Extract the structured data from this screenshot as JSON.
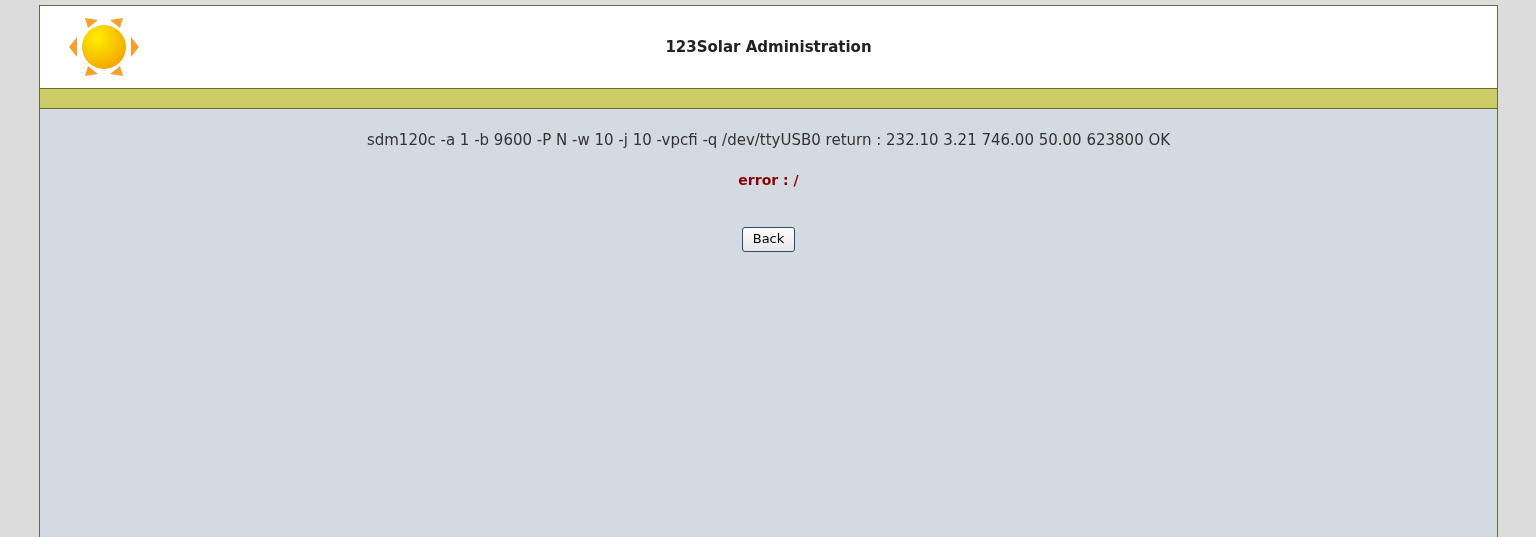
{
  "header": {
    "title": "123Solar Administration"
  },
  "content": {
    "command_output": "sdm120c -a 1 -b 9600 -P N -w 10 -j 10 -vpcfi -q /dev/ttyUSB0 return : 232.10 3.21 746.00 50.00 623800 OK",
    "error": "error : /",
    "button": "Back"
  }
}
